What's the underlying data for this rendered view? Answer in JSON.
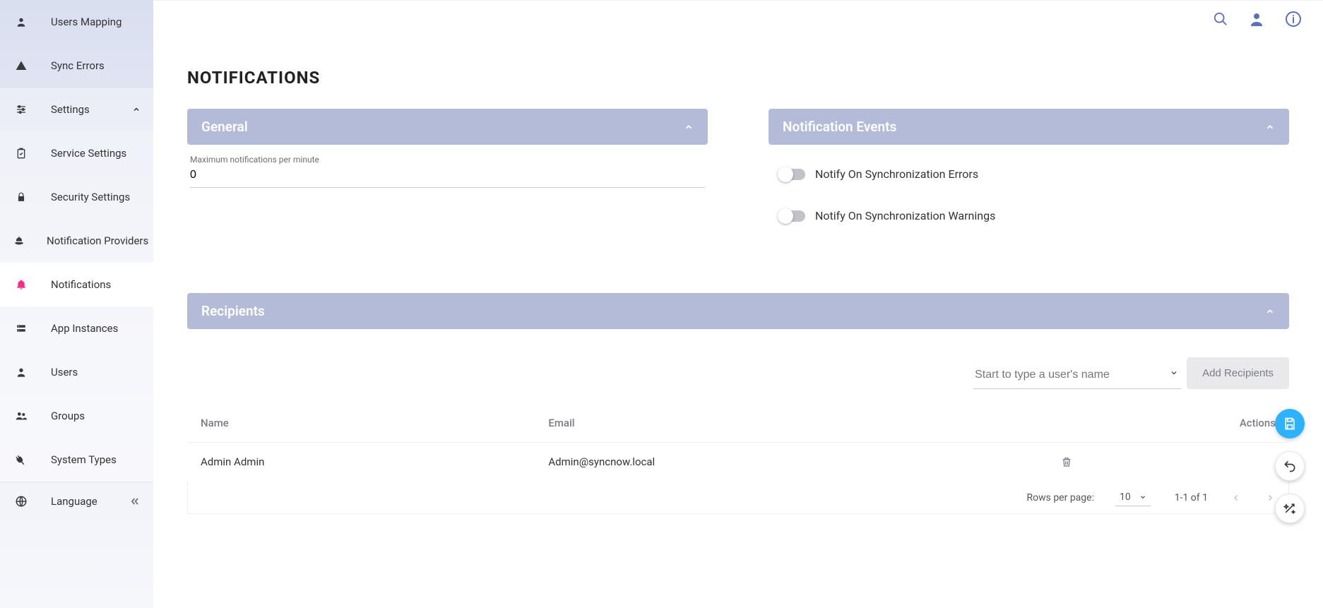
{
  "sidebar": {
    "items": [
      {
        "label": "Users Mapping",
        "icon": "user"
      },
      {
        "label": "Sync Errors",
        "icon": "warning"
      },
      {
        "label": "Settings",
        "icon": "sliders",
        "expanded": true
      },
      {
        "label": "Service Settings",
        "icon": "clipboard"
      },
      {
        "label": "Security Settings",
        "icon": "lock"
      },
      {
        "label": "Notification Providers",
        "icon": "hand-bell"
      },
      {
        "label": "Notifications",
        "icon": "bell",
        "active": true
      },
      {
        "label": "App Instances",
        "icon": "server"
      },
      {
        "label": "Users",
        "icon": "user"
      },
      {
        "label": "Groups",
        "icon": "users"
      },
      {
        "label": "System Types",
        "icon": "plug"
      }
    ],
    "footer": {
      "label": "Language",
      "icon": "globe"
    }
  },
  "topbar": {
    "search": "search",
    "user": "user",
    "info": "info"
  },
  "page": {
    "title": "NOTIFICATIONS"
  },
  "general": {
    "header": "General",
    "max_label": "Maximum notifications per minute",
    "max_value": "0"
  },
  "events": {
    "header": "Notification Events",
    "toggles": [
      {
        "label": "Notify On Synchronization Errors",
        "on": false
      },
      {
        "label": "Notify On Synchronization Warnings",
        "on": false
      }
    ]
  },
  "recipients": {
    "header": "Recipients",
    "picker_placeholder": "Start to type a user's name",
    "add_button": "Add Recipients",
    "columns": {
      "name": "Name",
      "email": "Email",
      "actions": "Actions"
    },
    "rows": [
      {
        "name": "Admin Admin",
        "email": "Admin@syncnow.local"
      }
    ],
    "footer": {
      "rpp_label": "Rows per page:",
      "rpp_value": "10",
      "range": "1-1 of 1"
    }
  }
}
